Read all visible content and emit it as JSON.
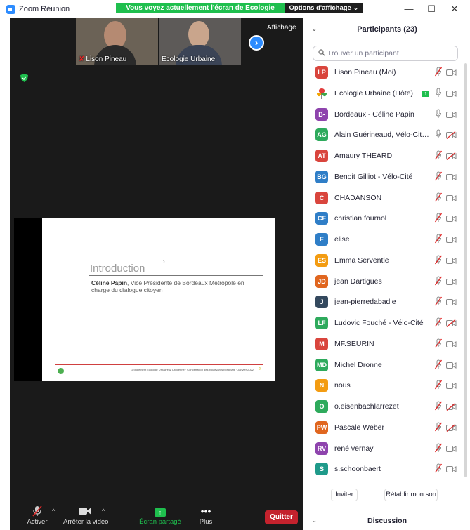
{
  "window": {
    "title": "Zoom Réunion",
    "share_banner": "Vous voyez actuellement l'écran de Ecologie Urbaine",
    "view_options": "Options d'affichage ⌄",
    "minimize": "—",
    "maximize": "☐",
    "close": "✕"
  },
  "meeting": {
    "view_button": "Affichage",
    "thumbnails": [
      {
        "name": "Lison Pineau",
        "muted": true
      },
      {
        "name": "Ecologie Urbaine",
        "muted": false
      }
    ],
    "slide": {
      "heading": "Introduction",
      "speaker": "Céline Papin",
      "speaker_role": ", Vice Présidente de Bordeaux Métropole en charge du dialogue citoyen",
      "footer": "Groupement Ecologie Urbaine & Citoyenne · Concertation des boulevards bordelais · Janvier 2022",
      "page_number": "2"
    }
  },
  "toolbar": {
    "mute": "Activer",
    "video": "Arrêter la vidéo",
    "share": "Écran partagé",
    "more": "Plus",
    "quit": "Quitter"
  },
  "panel": {
    "title": "Participants (23)",
    "search_placeholder": "Trouver un participant",
    "participants": [
      {
        "initials": "LP",
        "name": "Lison Pineau (Moi)",
        "color": "#d9453d",
        "mic": "muted",
        "cam": "off"
      },
      {
        "initials": "",
        "name": "Ecologie Urbaine (Hôte)",
        "color": "#ffffff",
        "mic": "on",
        "cam": "off",
        "sharing": true
      },
      {
        "initials": "B-",
        "name": "Bordeaux - Céline Papin",
        "color": "#8e44ad",
        "mic": "on",
        "cam": "off"
      },
      {
        "initials": "AG",
        "name": "Alain Guérineaud, Vélo-Cité Bor...",
        "color": "#2eaa5c",
        "mic": "on",
        "cam": "blocked"
      },
      {
        "initials": "AT",
        "name": "Amaury THEARD",
        "color": "#d9453d",
        "mic": "muted",
        "cam": "blocked"
      },
      {
        "initials": "BG",
        "name": "Benoit Gilliot - Vélo-Cité",
        "color": "#2f7ec7",
        "mic": "muted",
        "cam": "off"
      },
      {
        "initials": "C",
        "name": "CHADANSON",
        "color": "#d9453d",
        "mic": "muted",
        "cam": "off"
      },
      {
        "initials": "CF",
        "name": "christian fournol",
        "color": "#2f7ec7",
        "mic": "muted",
        "cam": "off"
      },
      {
        "initials": "E",
        "name": "elise",
        "color": "#2f7ec7",
        "mic": "muted",
        "cam": "off"
      },
      {
        "initials": "ES",
        "name": "Emma Serventie",
        "color": "#f39c12",
        "mic": "muted",
        "cam": "off"
      },
      {
        "initials": "JD",
        "name": "jean Dartigues",
        "color": "#e0661f",
        "mic": "muted",
        "cam": "off"
      },
      {
        "initials": "J",
        "name": "jean-pierredabadie",
        "color": "#34495e",
        "mic": "muted",
        "cam": "off"
      },
      {
        "initials": "LF",
        "name": "Ludovic Fouché - Vélo-Cité",
        "color": "#2eaa5c",
        "mic": "muted",
        "cam": "blocked"
      },
      {
        "initials": "M",
        "name": "MF.SEURIN",
        "color": "#d9453d",
        "mic": "muted",
        "cam": "off"
      },
      {
        "initials": "MD",
        "name": "Michel Dronne",
        "color": "#2eaa5c",
        "mic": "muted",
        "cam": "off"
      },
      {
        "initials": "N",
        "name": "nous",
        "color": "#f39c12",
        "mic": "muted",
        "cam": "off"
      },
      {
        "initials": "O",
        "name": "o.eisenbachlarrezet",
        "color": "#2eaa5c",
        "mic": "muted",
        "cam": "blocked"
      },
      {
        "initials": "PW",
        "name": "Pascale Weber",
        "color": "#e0661f",
        "mic": "muted",
        "cam": "blocked"
      },
      {
        "initials": "RV",
        "name": "rené vernay",
        "color": "#8e44ad",
        "mic": "muted",
        "cam": "off"
      },
      {
        "initials": "S",
        "name": "s.schoonbaert",
        "color": "#1f9a8a",
        "mic": "muted",
        "cam": "off"
      }
    ],
    "invite": "Inviter",
    "reclaim": "Rétablir mon son",
    "chat": "Discussion"
  }
}
